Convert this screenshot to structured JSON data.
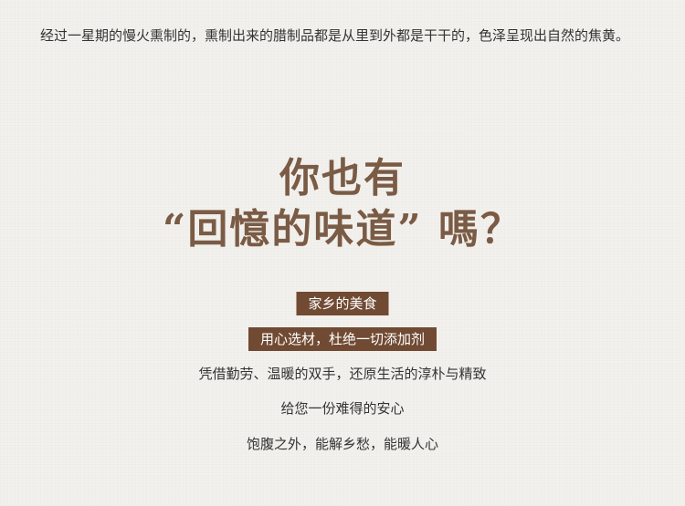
{
  "intro": {
    "text": "经过一星期的慢火熏制的，熏制出来的腊制品都是从里到外都是干干的，色泽呈现出自然的焦黄。"
  },
  "headline": {
    "line1": "你也有",
    "line2": "“回憶的味道” 嗎？"
  },
  "tags": [
    {
      "label": "家乡的美食"
    },
    {
      "label": "用心选材，杜绝一切添加剂"
    }
  ],
  "lines": [
    {
      "text": "凭借勤劳、温暖的双手，还原生活的淳朴与精致"
    },
    {
      "text": "给您一份难得的安心"
    },
    {
      "text": "饱腹之外，能解乡愁，能暖人心"
    }
  ],
  "colors": {
    "background": "#f3f1ed",
    "headline": "#7a5b45",
    "tag_background": "#714a33",
    "body_text": "#333333"
  }
}
